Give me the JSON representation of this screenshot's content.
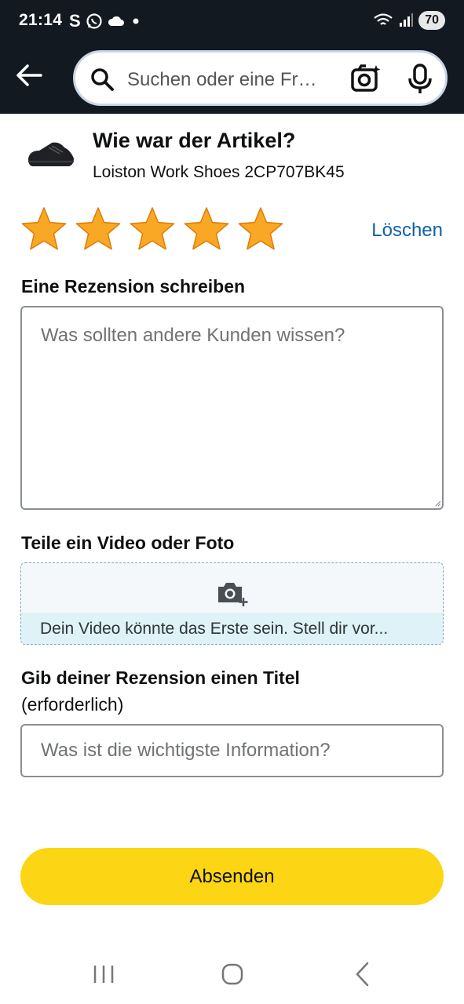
{
  "status_bar": {
    "time": "21:14",
    "left_icons": [
      "s-icon",
      "whatsapp-icon",
      "cloud-icon",
      "dot-icon"
    ],
    "s_label": "S",
    "right_icons": [
      "wifi-icon",
      "signal-icon"
    ],
    "battery": "70"
  },
  "search": {
    "placeholder": "Suchen oder eine Fr…",
    "icons": [
      "back-arrow-icon",
      "search-icon",
      "camera-sparkle-icon",
      "microphone-icon"
    ]
  },
  "product": {
    "question": "Wie war der Artikel?",
    "name": "Loiston Work Shoes 2CP707BK45"
  },
  "rating": {
    "value": 5,
    "max": 5,
    "star_color": "#f9a825",
    "clear_label": "Löschen"
  },
  "review": {
    "heading": "Eine Rezension schreiben",
    "placeholder": "Was sollten andere Kunden wissen?"
  },
  "media": {
    "heading": "Teile ein Video oder Foto",
    "hint": "Dein Video könnte das Erste sein. Stell dir vor..."
  },
  "title": {
    "heading": "Gib deiner Rezension einen Titel",
    "required": "(erforderlich)",
    "placeholder": "Was ist die wichtigste Information?"
  },
  "submit": {
    "label": "Absenden",
    "color": "#fcd515"
  },
  "nav_bar": {
    "icons": [
      "recent-apps-icon",
      "home-icon",
      "back-icon"
    ]
  }
}
